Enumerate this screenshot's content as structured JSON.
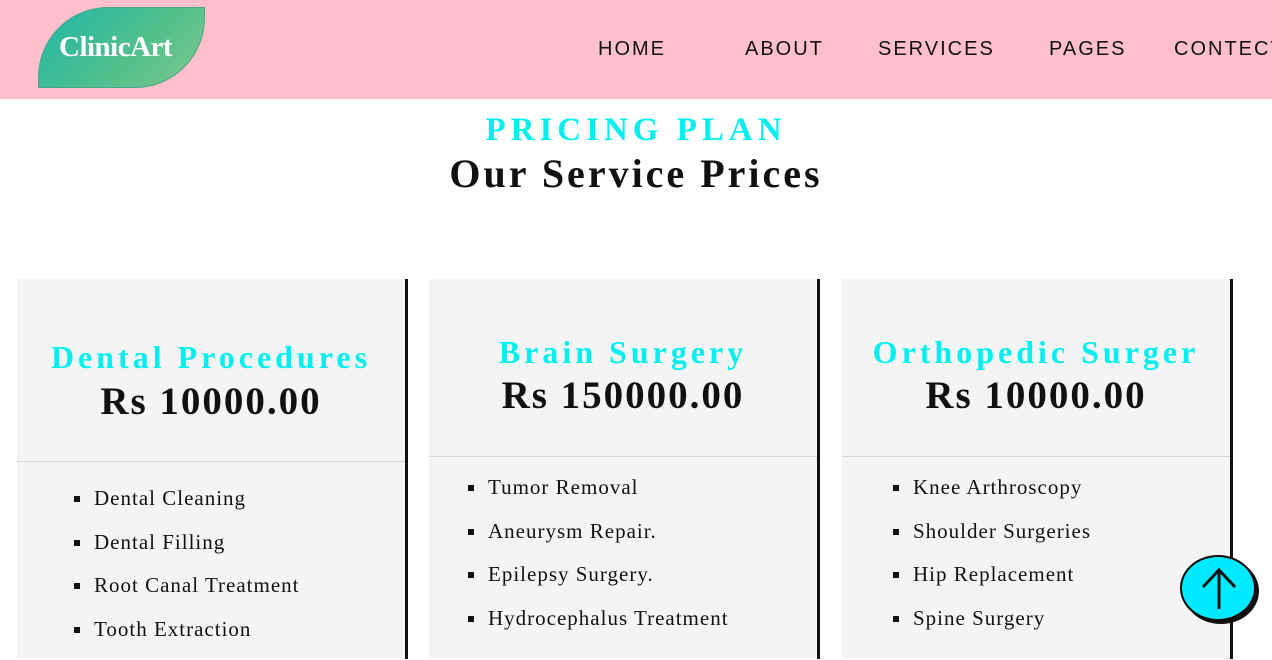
{
  "header": {
    "logo_text": "ClinicArt",
    "nav": [
      "HOME",
      "ABOUT",
      "SERVICES",
      "PAGES",
      "CONTECT"
    ]
  },
  "section": {
    "kicker": "PRICING PLAN",
    "title": "Our Service Prices"
  },
  "cards": [
    {
      "name": "Dental Procedures",
      "price": "Rs 10000.00",
      "items": [
        "Dental Cleaning",
        "Dental Filling",
        "Root Canal Treatment",
        "Tooth Extraction"
      ]
    },
    {
      "name": "Brain Surgery",
      "price": "Rs 150000.00",
      "items": [
        "Tumor Removal",
        "Aneurysm Repair.",
        "Epilepsy Surgery.",
        "Hydrocephalus Treatment"
      ]
    },
    {
      "name": "Orthopedic Surger",
      "price": "Rs 10000.00",
      "items": [
        "Knee Arthroscopy",
        "Shoulder Surgeries",
        "Hip Replacement",
        "Spine Surgery"
      ]
    }
  ],
  "colors": {
    "header_bg": "#ffc0cb",
    "accent": "#00f0f0",
    "card_bg": "#f4f4f4"
  },
  "icons": {
    "back_to_top": "arrow-up-icon"
  }
}
